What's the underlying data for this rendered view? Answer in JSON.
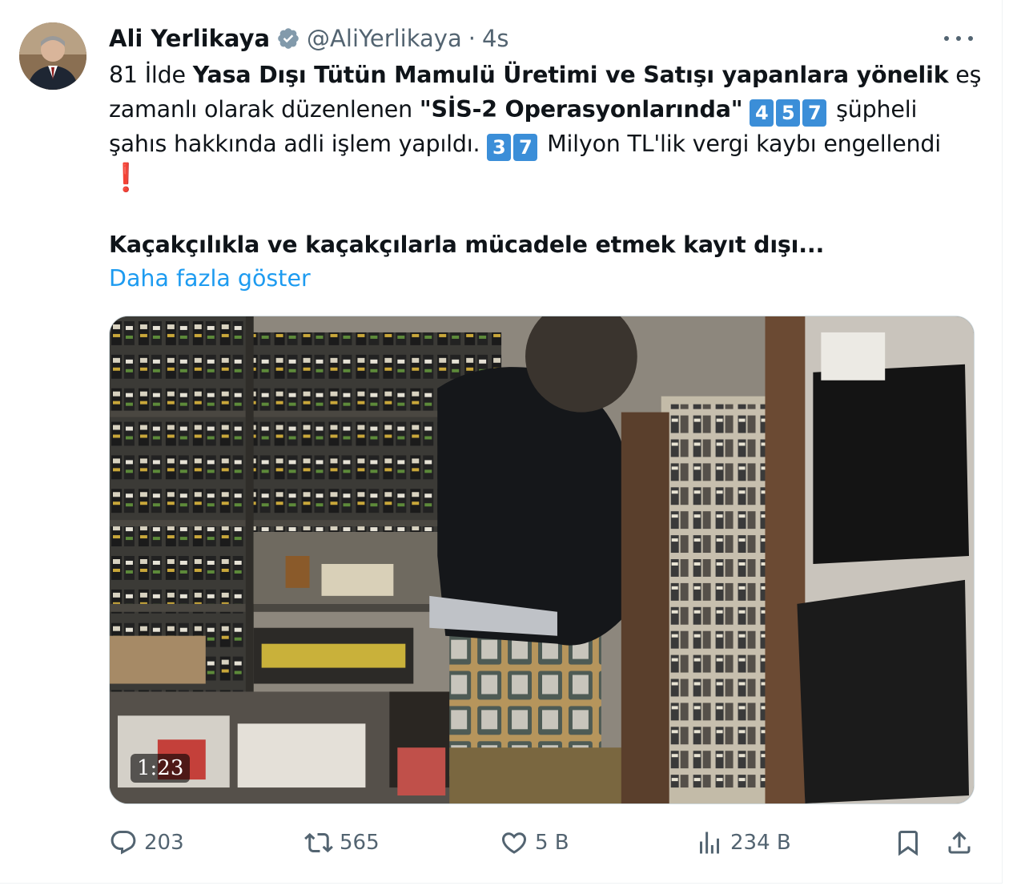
{
  "tweet": {
    "author_name": "Ali Yerlikaya",
    "handle": "@AliYerlikaya",
    "separator": "·",
    "time": "4s",
    "line1_pre": "81 İlde ",
    "line1_bold": "Yasa Dışı Tütün Mamulü Üretimi ve Satışı yapanlara yönelik",
    "line1_post": " eş zamanlı olarak düzenlenen ",
    "op_name": "\"SİS-2 Operasyonlarında\"",
    "suspects_digits": [
      "4",
      "5",
      "7"
    ],
    "line2_post": " şüpheli şahıs hakkında adli işlem yapıldı. ",
    "loss_digits": [
      "3",
      "7"
    ],
    "line3_post": " Milyon TL'lik vergi kaybı engellendi",
    "exclaim": "❗",
    "paragraph2": "Kaçakçılıkla ve kaçakçılarla mücadele etmek kayıt dışı...",
    "show_more": "Daha fazla göster",
    "video_duration": "1:23"
  },
  "actions": {
    "replies": "203",
    "reposts": "565",
    "likes": "5 B",
    "views": "234 B"
  },
  "icons": [
    "verified-badge-icon",
    "more-options-icon",
    "reply-icon",
    "repost-icon",
    "like-icon",
    "views-icon",
    "bookmark-icon",
    "share-icon"
  ],
  "colors": {
    "accent": "#1d9bf0",
    "muted": "#536471",
    "keycap": "#3b8ed8",
    "exclaim": "#e0242e"
  }
}
